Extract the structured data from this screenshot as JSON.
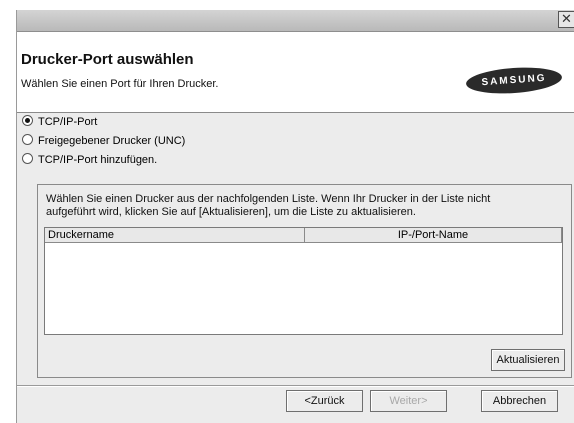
{
  "window": {
    "close_glyph": "✕"
  },
  "header": {
    "title": "Drucker-Port auswählen",
    "subtitle": "Wählen Sie einen Port für Ihren Drucker.",
    "logo_text": "SAMSUNG"
  },
  "port_options": [
    {
      "label": "TCP/IP-Port",
      "selected": true
    },
    {
      "label": "Freigegebener Drucker (UNC)",
      "selected": false
    },
    {
      "label": "TCP/IP-Port hinzufügen.",
      "selected": false
    }
  ],
  "printer_group": {
    "instructions_line1": "Wählen Sie einen Drucker aus der nachfolgenden Liste. Wenn Ihr Drucker in der Liste nicht",
    "instructions_line2": "aufgeführt wird, klicken Sie auf [Aktualisieren], um die Liste zu aktualisieren.",
    "columns": [
      "Druckername",
      "IP-/Port-Name"
    ],
    "rows": [],
    "refresh_label": "Aktualisieren"
  },
  "footer": {
    "back_label": "<Zurück",
    "next_label": "Weiter>",
    "next_enabled": false,
    "cancel_label": "Abbrechen"
  }
}
